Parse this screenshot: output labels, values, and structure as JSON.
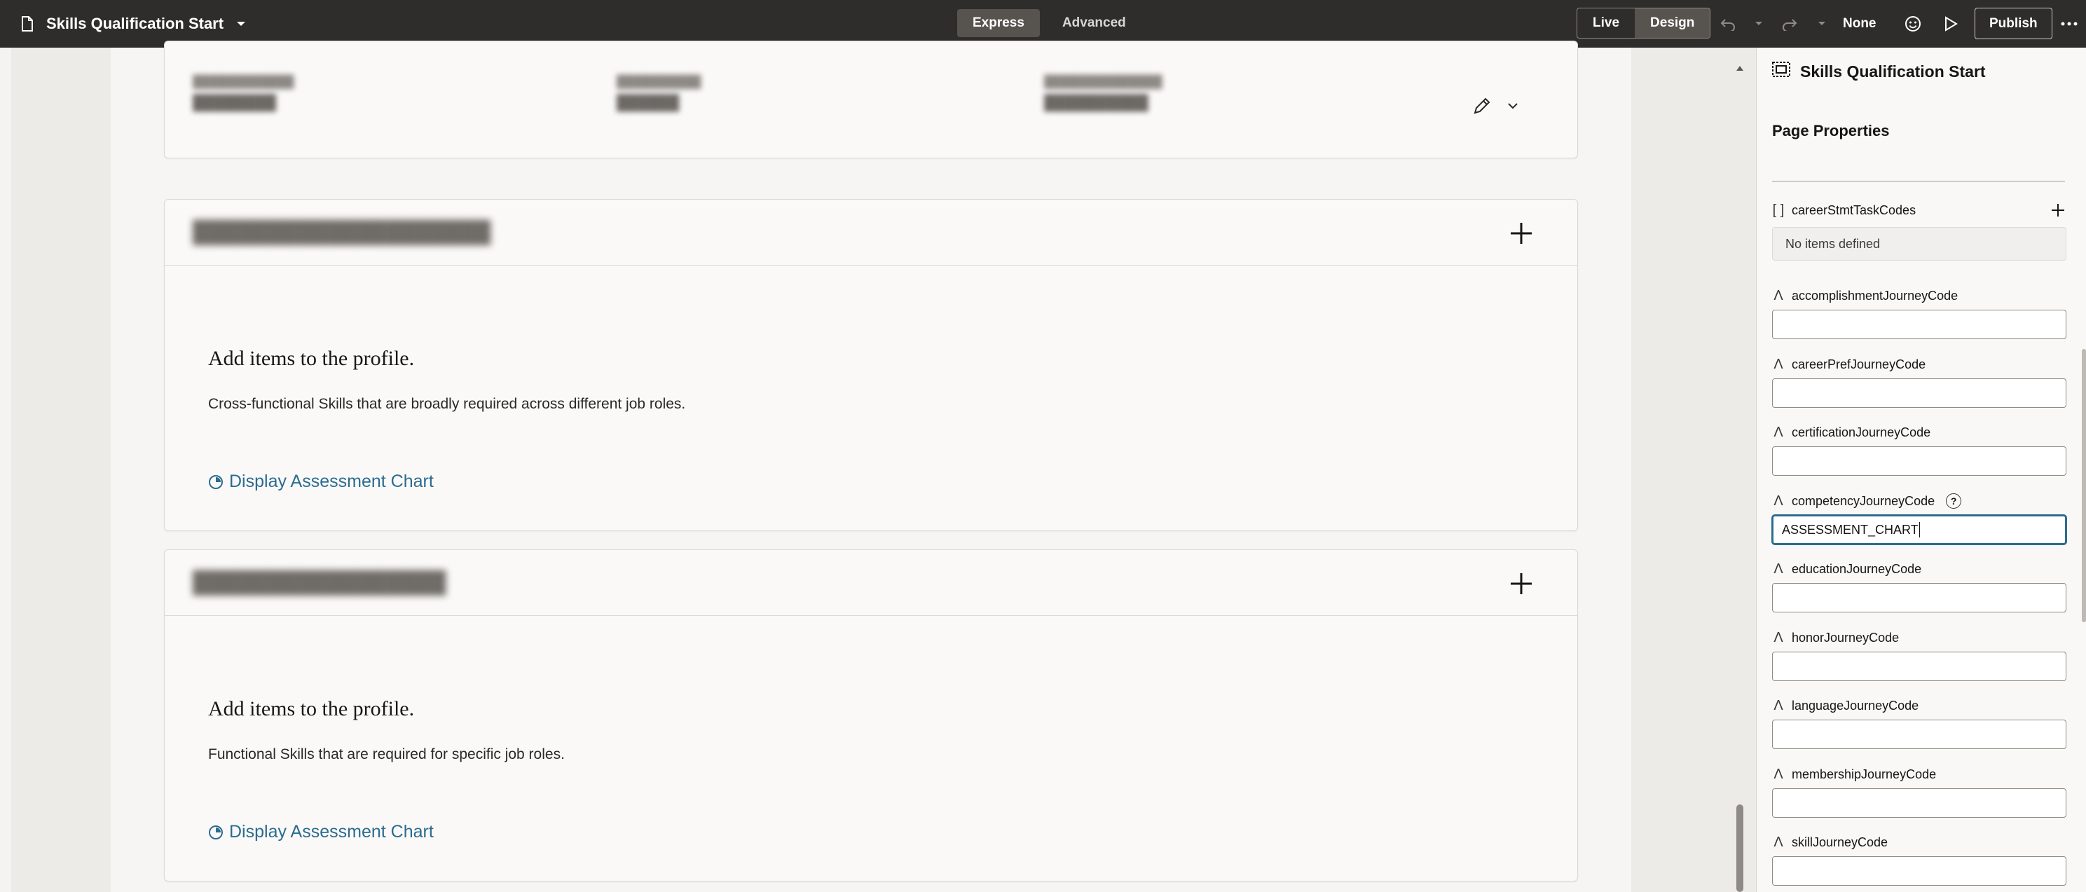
{
  "topbar": {
    "title": "Skills Qualification Start",
    "modes": [
      "Express",
      "Advanced"
    ],
    "active_mode": "Express",
    "view_toggle": [
      "Live",
      "Design"
    ],
    "active_view": "Design",
    "none_label": "None",
    "publish_label": "Publish"
  },
  "cards": [
    {
      "heading": "Add items to the profile.",
      "description": "Cross-functional Skills that are broadly required across different job roles.",
      "link": "Display Assessment Chart"
    },
    {
      "heading": "Add items to the profile.",
      "description": "Functional Skills that are required for specific job roles.",
      "link": "Display Assessment Chart"
    }
  ],
  "panel": {
    "title": "Skills Qualification Start",
    "section": "Page Properties",
    "array_prop": {
      "label": "careerStmtTaskCodes",
      "empty_text": "No items defined"
    },
    "props": [
      {
        "label": "accomplishmentJourneyCode",
        "value": ""
      },
      {
        "label": "careerPrefJourneyCode",
        "value": ""
      },
      {
        "label": "certificationJourneyCode",
        "value": ""
      },
      {
        "label": "competencyJourneyCode",
        "value": "ASSESSMENT_CHART"
      },
      {
        "label": "educationJourneyCode",
        "value": ""
      },
      {
        "label": "honorJourneyCode",
        "value": ""
      },
      {
        "label": "languageJourneyCode",
        "value": ""
      },
      {
        "label": "membershipJourneyCode",
        "value": ""
      },
      {
        "label": "skillJourneyCode",
        "value": ""
      }
    ]
  }
}
